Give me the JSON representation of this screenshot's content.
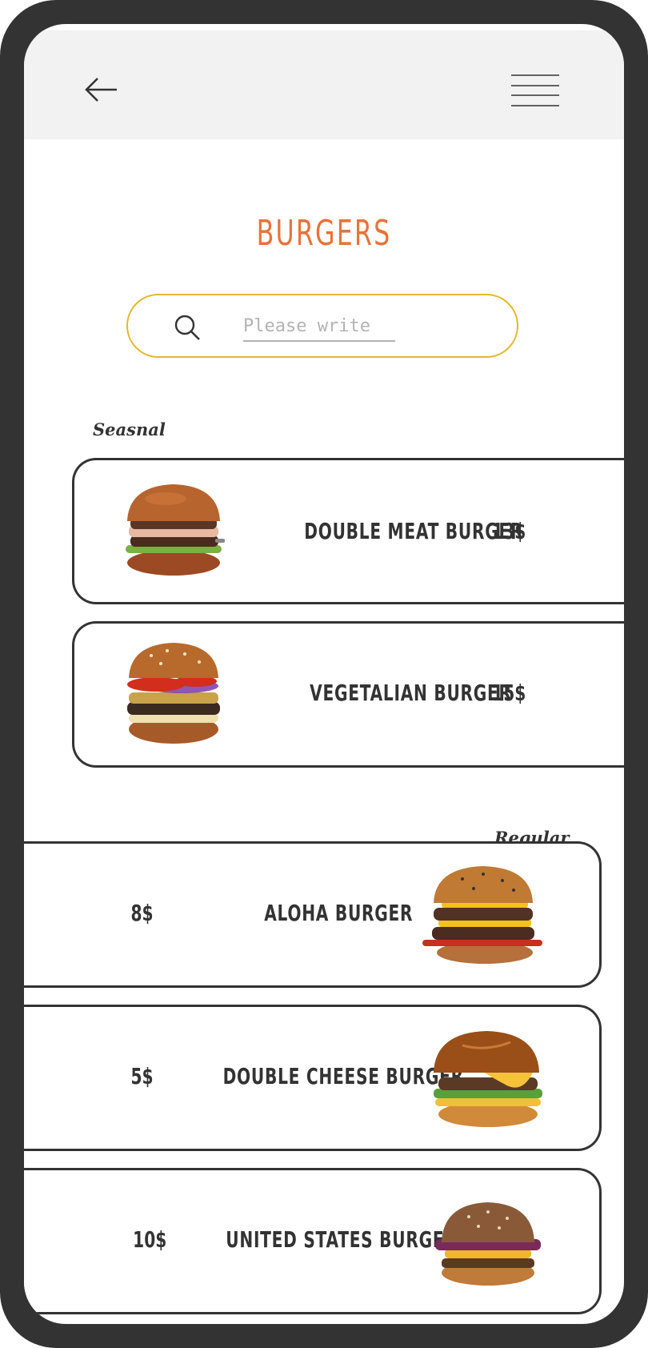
{
  "header": {
    "back_icon": "arrow-left-icon",
    "menu_icon": "hamburger-menu-icon"
  },
  "page": {
    "title": "BURGERS"
  },
  "search": {
    "placeholder": "Please write",
    "icon": "search-icon"
  },
  "sections": {
    "seasonal": {
      "label": "Seasnal",
      "items": [
        {
          "name": "DOUBLE MEAT BURGER",
          "price": "13$"
        },
        {
          "name": "VEGETALIAN BURGER",
          "price": "15$"
        }
      ]
    },
    "regular": {
      "label": "Regular",
      "items": [
        {
          "name": "ALOHA BURGER",
          "price": "8$"
        },
        {
          "name": "DOUBLE CHEESE BURGER",
          "price": "5$"
        },
        {
          "name": "UNITED STATES BURGER",
          "price": "10$"
        }
      ]
    }
  },
  "colors": {
    "accent": "#e8733a",
    "search_border": "#e5b728",
    "frame": "#333333",
    "header_bg": "#f2f2f2"
  }
}
